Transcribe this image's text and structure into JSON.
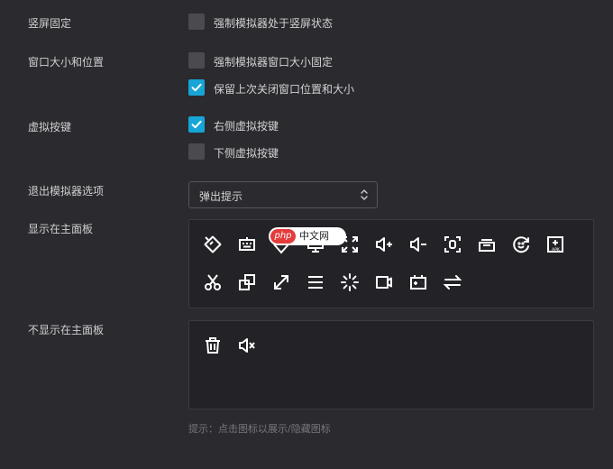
{
  "settings": {
    "portrait_lock": {
      "label": "竖屏固定",
      "option": "强制模拟器处于竖屏状态",
      "checked": false
    },
    "window_size": {
      "label": "窗口大小和位置",
      "options": [
        {
          "text": "强制模拟器窗口大小固定",
          "checked": false
        },
        {
          "text": "保留上次关闭窗口位置和大小",
          "checked": true
        }
      ]
    },
    "virtual_keys": {
      "label": "虚拟按键",
      "options": [
        {
          "text": "右侧虚拟按键",
          "checked": true
        },
        {
          "text": "下侧虚拟按键",
          "checked": false
        }
      ]
    },
    "exit_option": {
      "label": "退出模拟器选项",
      "selected": "弹出提示"
    },
    "show_panel": {
      "label": "显示在主面板",
      "icons": [
        "rotate-icon",
        "keyboard-icon",
        "location-icon",
        "screen-icon",
        "fullscreen-icon",
        "volume-up-icon",
        "volume-down-icon",
        "screenshot-icon",
        "multi-instance-icon",
        "sync-icon",
        "apk-install-icon",
        "scissors-icon",
        "copy-window-icon",
        "resize-icon",
        "menu-icon",
        "loading-icon",
        "video-record-icon",
        "gamepad-icon",
        "switch-icon"
      ]
    },
    "hide_panel": {
      "label": "不显示在主面板",
      "icons": [
        "trash-icon",
        "mute-icon"
      ]
    },
    "hint": "提示：点击图标以展示/隐藏图标"
  },
  "watermark": {
    "brand": "php",
    "text": "中文网"
  },
  "colors": {
    "background": "#2b2a2f",
    "accent": "#17a4d6",
    "panel": "#232227"
  }
}
